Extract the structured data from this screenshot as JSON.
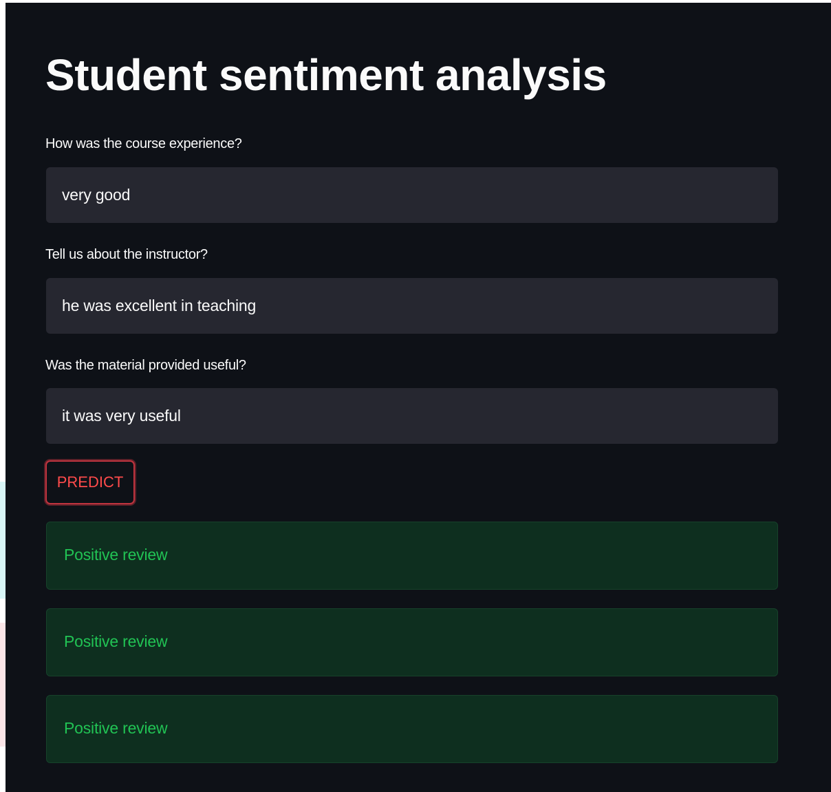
{
  "page": {
    "title": "Student sentiment analysis"
  },
  "form": {
    "fields": [
      {
        "label": "How was the course experience?",
        "value": "very good"
      },
      {
        "label": "Tell us about the instructor?",
        "value": "he was excellent in teaching"
      },
      {
        "label": "Was the material provided useful?",
        "value": "it was very useful"
      }
    ],
    "predict_label": "PREDICT"
  },
  "results": [
    {
      "text": "Positive review"
    },
    {
      "text": "Positive review"
    },
    {
      "text": "Positive review"
    }
  ],
  "colors": {
    "background": "#0e1117",
    "input_background": "#262730",
    "text": "#fafafa",
    "button_accent": "#ff4b4b",
    "success_background": "#0e2f1f",
    "success_text": "#21c354"
  }
}
